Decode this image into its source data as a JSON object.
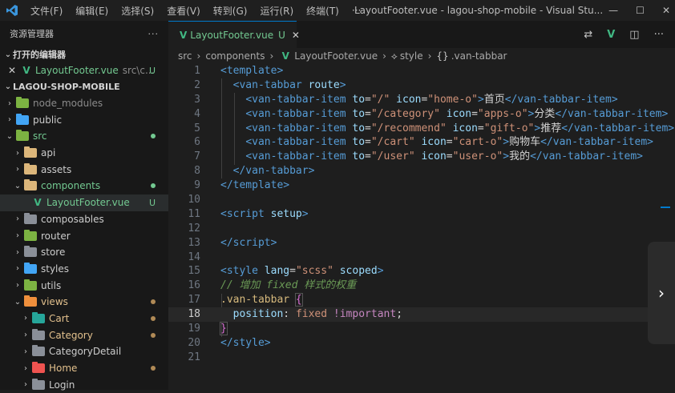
{
  "titlebar": {
    "menus": [
      "文件(F)",
      "编辑(E)",
      "选择(S)",
      "查看(V)",
      "转到(G)",
      "运行(R)",
      "终端(T)",
      "···"
    ],
    "title": "LayoutFooter.vue - lagou-shop-mobile - Visual Stu...",
    "window_controls": [
      "minimize-icon",
      "maximize-icon",
      "close-icon"
    ]
  },
  "sidebar": {
    "header": "资源管理器",
    "more": "···",
    "open_editors": {
      "label": "打开的编辑器",
      "item": {
        "name": "LayoutFooter.vue",
        "path": "src\\c...",
        "status": "U"
      }
    },
    "project": "LAGOU-SHOP-MOBILE",
    "tree": [
      {
        "name": "node_modules",
        "depth": 1,
        "expanded": false,
        "kind": "folder-node"
      },
      {
        "name": "public",
        "depth": 1,
        "expanded": false,
        "kind": "folder-public"
      },
      {
        "name": "src",
        "depth": 1,
        "expanded": true,
        "kind": "folder-src",
        "dot": true
      },
      {
        "name": "api",
        "depth": 2,
        "expanded": false,
        "kind": "folder"
      },
      {
        "name": "assets",
        "depth": 2,
        "expanded": false,
        "kind": "folder"
      },
      {
        "name": "components",
        "depth": 2,
        "expanded": true,
        "kind": "folder",
        "dot": true
      },
      {
        "name": "LayoutFooter.vue",
        "depth": 3,
        "kind": "vue",
        "status": "U"
      },
      {
        "name": "composables",
        "depth": 2,
        "expanded": false,
        "kind": "folder-gray"
      },
      {
        "name": "router",
        "depth": 2,
        "expanded": false,
        "kind": "folder-green"
      },
      {
        "name": "store",
        "depth": 2,
        "expanded": false,
        "kind": "folder-gray"
      },
      {
        "name": "styles",
        "depth": 2,
        "expanded": false,
        "kind": "folder-blue"
      },
      {
        "name": "utils",
        "depth": 2,
        "expanded": false,
        "kind": "folder-green"
      },
      {
        "name": "views",
        "depth": 2,
        "expanded": true,
        "kind": "folder-orange",
        "dot": true
      },
      {
        "name": "Cart",
        "depth": 3,
        "expanded": false,
        "kind": "folder-teal",
        "dot": true
      },
      {
        "name": "Category",
        "depth": 3,
        "expanded": false,
        "kind": "folder-gray",
        "dot": true
      },
      {
        "name": "CategoryDetail",
        "depth": 3,
        "expanded": false,
        "kind": "folder-gray"
      },
      {
        "name": "Home",
        "depth": 3,
        "expanded": false,
        "kind": "folder-red",
        "dot": true
      },
      {
        "name": "Login",
        "depth": 3,
        "expanded": false,
        "kind": "folder-gray"
      }
    ]
  },
  "tab": {
    "name": "LayoutFooter.vue",
    "status": "U",
    "close": "✕"
  },
  "breadcrumb": [
    "src",
    "components",
    "LayoutFooter.vue",
    "style",
    ".van-tabbar"
  ],
  "editor": {
    "current_line": 18,
    "lines": [
      {
        "n": "1"
      },
      {
        "n": "2"
      },
      {
        "n": "3"
      },
      {
        "n": "4"
      },
      {
        "n": "5"
      },
      {
        "n": "6"
      },
      {
        "n": "7"
      },
      {
        "n": "8"
      },
      {
        "n": "9"
      },
      {
        "n": "10"
      },
      {
        "n": "11"
      },
      {
        "n": "12"
      },
      {
        "n": "13"
      },
      {
        "n": "14"
      },
      {
        "n": "15"
      },
      {
        "n": "16"
      },
      {
        "n": "17"
      },
      {
        "n": "18"
      },
      {
        "n": "19"
      },
      {
        "n": "20"
      },
      {
        "n": "21"
      }
    ],
    "tabbar_items": [
      {
        "to": "\"/\"",
        "icon": "\"home-o\"",
        "label": "首页"
      },
      {
        "to": "\"/category\"",
        "icon": "\"apps-o\"",
        "label": "分类"
      },
      {
        "to": "\"/recommend\"",
        "icon": "\"gift-o\"",
        "label": "推荐"
      },
      {
        "to": "\"/cart\"",
        "icon": "\"cart-o\"",
        "label": "购物车"
      },
      {
        "to": "\"/user\"",
        "icon": "\"user-o\"",
        "label": "我的"
      }
    ],
    "comment": "// 增加 fixed 样式的权重",
    "selector": ".van-tabbar",
    "property": "position",
    "value": "fixed",
    "important": "!important",
    "style_lang": "\"scss\""
  },
  "colors": {
    "accent": "#007acc",
    "vue": "#41b883",
    "untracked": "#73c991"
  }
}
